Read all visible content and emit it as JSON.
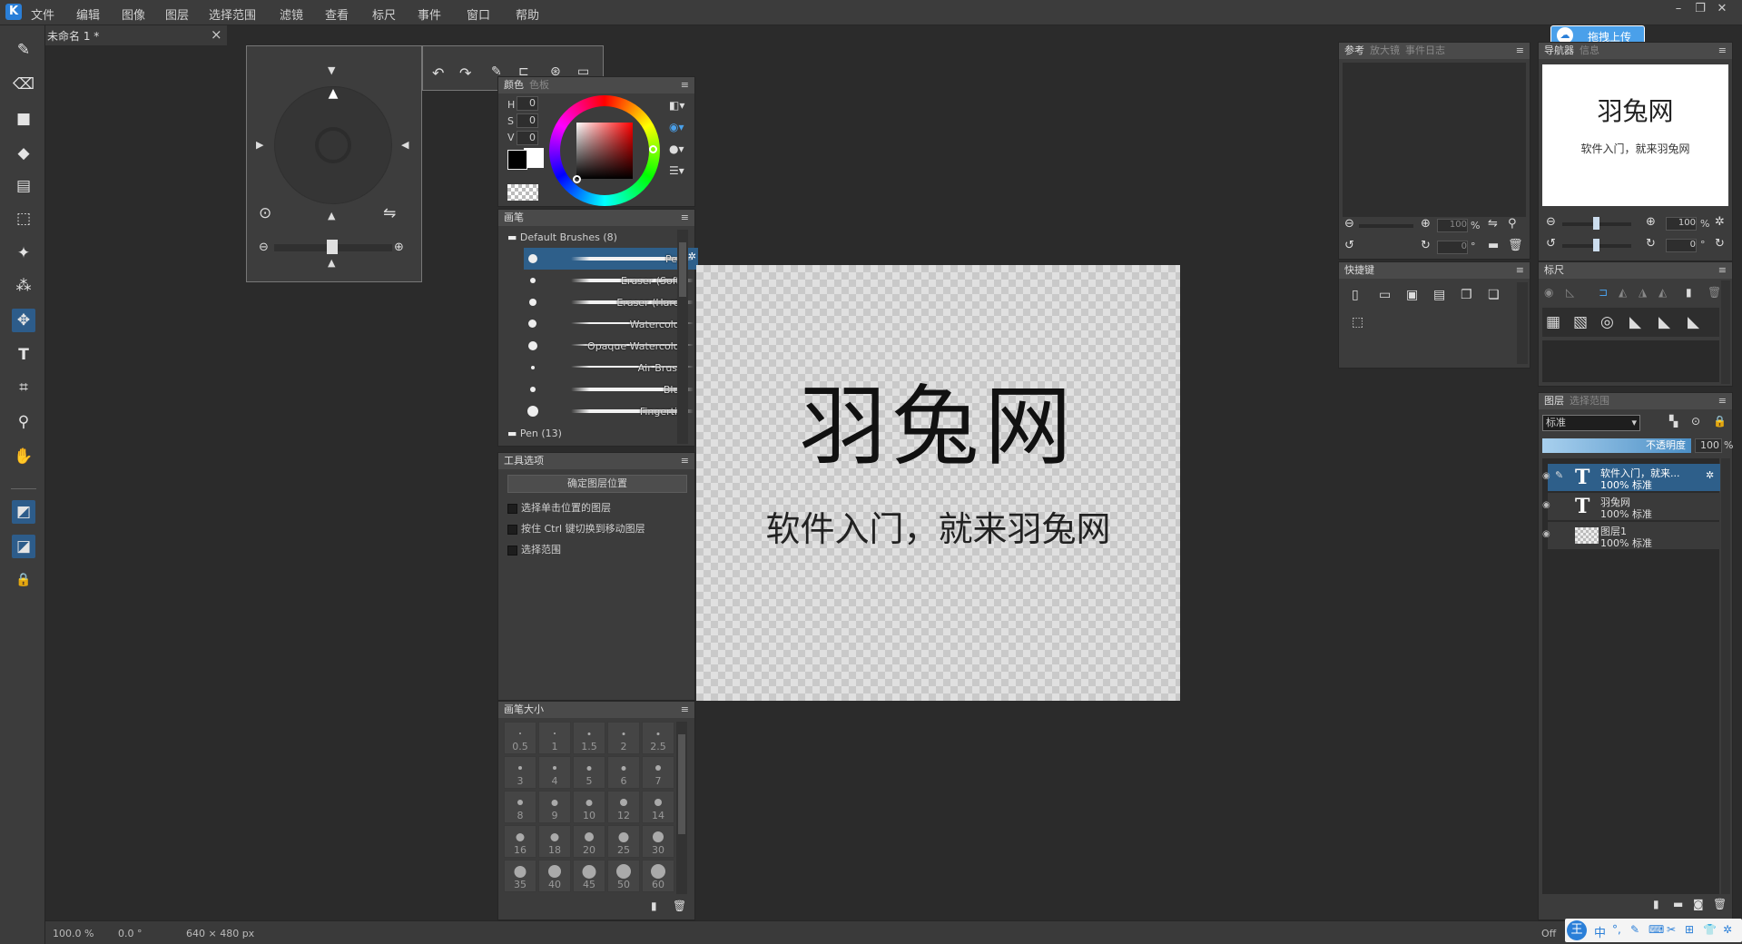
{
  "menu": [
    "文件",
    "编辑",
    "图像",
    "图层",
    "选择范围",
    "滤镜",
    "查看",
    "标尺",
    "事件",
    "窗口",
    "帮助"
  ],
  "logo": "K",
  "document_tab": "未命名 1 *",
  "tab_close": "×",
  "window_controls": [
    "–",
    "❐",
    "✕"
  ],
  "upload_button": "拖拽上传",
  "canvas_text": {
    "title": "羽兔网",
    "subtitle": "软件入门，就来羽兔网"
  },
  "color_panel": {
    "tabs": [
      "颜色",
      "色板"
    ],
    "h_label": "H",
    "h": "0",
    "s_label": "S",
    "s": "0",
    "v_label": "V",
    "v": "0"
  },
  "brush_panel": {
    "title": "画笔",
    "group1": "Default Brushes (8)",
    "group2": "Pen (13)",
    "brushes": [
      "Pen",
      "Eraser (Soft)",
      "Eraser (Hard)",
      "Watercolor",
      "Opaque Watercolor",
      "Air Brush",
      "Blur",
      "Fingertip"
    ]
  },
  "tool_options": {
    "title": "工具选项",
    "button": "确定图层位置",
    "options": [
      "选择单击位置的图层",
      "按住 Ctrl 键切换到移动图层",
      "选择范围"
    ]
  },
  "brush_size": {
    "title": "画笔大小",
    "sizes": [
      "0.5",
      "1",
      "1.5",
      "2",
      "2.5",
      "3",
      "4",
      "5",
      "6",
      "7",
      "8",
      "9",
      "10",
      "12",
      "14",
      "16",
      "18",
      "20",
      "25",
      "30",
      "35",
      "40",
      "45",
      "50",
      "60"
    ]
  },
  "reference_panel": {
    "tabs": [
      "参考",
      "放大镜",
      "事件日志"
    ],
    "zoom": "100",
    "pct": "%",
    "angle": "0",
    "deg": "°"
  },
  "shortcuts_panel": {
    "title": "快捷键"
  },
  "navigator_panel": {
    "tabs": [
      "导航器",
      "信息"
    ],
    "thumb_title": "羽兔网",
    "thumb_sub": "软件入门，就来羽兔网",
    "zoom": "100",
    "pct": "%",
    "angle": "0",
    "deg": "°"
  },
  "ruler_panel": {
    "title": "标尺"
  },
  "layers_panel": {
    "tabs": [
      "图层",
      "选择范围"
    ],
    "blend": "标准",
    "opacity_label": "不透明度",
    "opacity": "100",
    "pct": "%",
    "layers": [
      {
        "name": "软件入门，就来...",
        "info": "100% 标准",
        "icon": "T"
      },
      {
        "name": "羽兔网",
        "info": "100% 标准",
        "icon": "T"
      },
      {
        "name": "图层1",
        "info": "100% 标准",
        "icon": ""
      }
    ]
  },
  "status": {
    "zoom": "100.0 %",
    "angle": "0.0 °",
    "size": "640 × 480 px",
    "mode": "Off"
  },
  "ime": [
    "王",
    "中",
    "°,",
    "✎",
    "⌨",
    "✂",
    "⊞",
    "👕",
    "✲"
  ]
}
